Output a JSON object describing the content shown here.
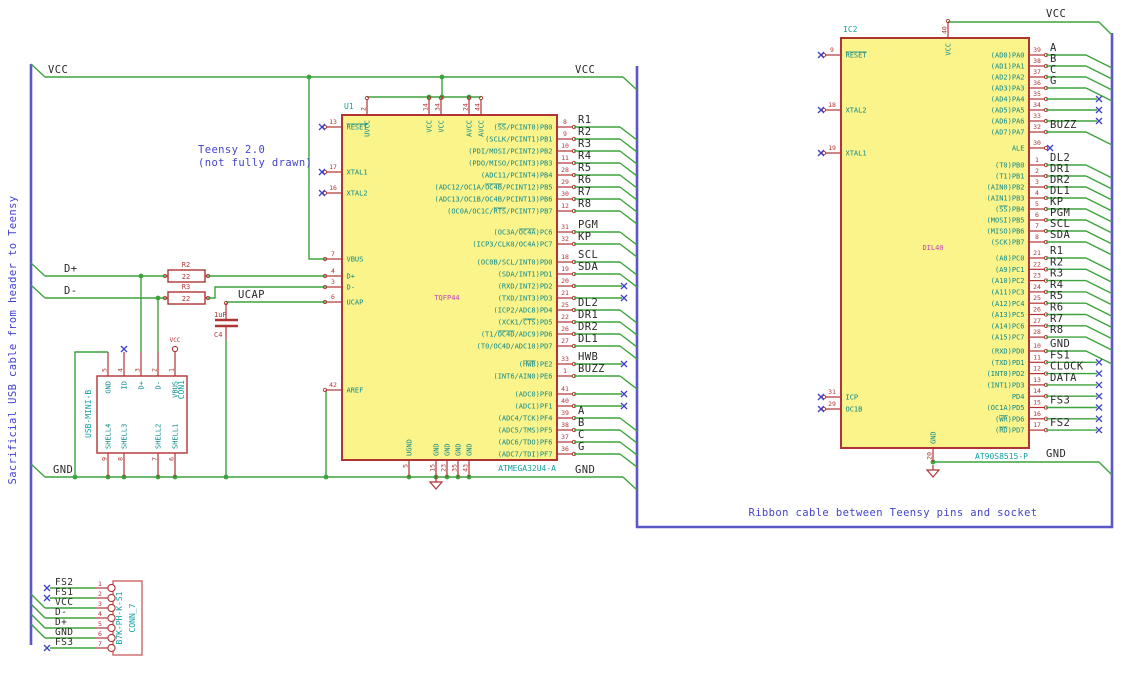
{
  "notes": {
    "sacrificial": "Sacrificial USB cable from header to Teensy",
    "teensy_line1": "Teensy 2.0",
    "teensy_line2": "(not fully drawn)",
    "ribbon": "Ribbon cable between Teensy pins and socket"
  },
  "net_labels": {
    "vcc": "VCC",
    "gnd": "GND",
    "ucap": "UCAP",
    "dplus": "D+",
    "dminus": "D-"
  },
  "u1": {
    "ref": "U1",
    "value": "ATMEGA32U4-A",
    "footprint": "TQFP44",
    "left_pins": [
      {
        "num": "13",
        "name": "|RESET|",
        "conn": "nc"
      },
      {
        "num": "17",
        "name": "XTAL1",
        "conn": "nc"
      },
      {
        "num": "16",
        "name": "XTAL2",
        "conn": "nc"
      },
      {
        "num": "7",
        "name": "VBUS",
        "conn": "wire"
      },
      {
        "num": "4",
        "name": "D+",
        "conn": "wire"
      },
      {
        "num": "3",
        "name": "D-",
        "conn": "wire"
      },
      {
        "num": "6",
        "name": "UCAP",
        "conn": "wire"
      },
      {
        "num": "42",
        "name": "AREF",
        "conn": "wire"
      }
    ],
    "top_pins": [
      {
        "num": "2",
        "name": "UVCC"
      },
      {
        "num": "14",
        "name": "VCC"
      },
      {
        "num": "34",
        "name": "VCC"
      },
      {
        "num": "24",
        "name": "AVCC"
      },
      {
        "num": "44",
        "name": "AVCC"
      }
    ],
    "bottom_pins": [
      {
        "num": "5",
        "name": "UGND"
      },
      {
        "num": "15",
        "name": "GND"
      },
      {
        "num": "23",
        "name": "GND"
      },
      {
        "num": "35",
        "name": "GND"
      },
      {
        "num": "43",
        "name": "GND"
      }
    ],
    "right_groups": [
      [
        {
          "num": "8",
          "name": "(|SS|/PCINT0)PB0",
          "net": "R1"
        },
        {
          "num": "9",
          "name": "(SCLK/PCINT1)PB1",
          "net": "R2"
        },
        {
          "num": "10",
          "name": "(PDI/MOSI/PCINT2)PB2",
          "net": "R3"
        },
        {
          "num": "11",
          "name": "(PDO/MISO/PCINT3)PB3",
          "net": "R4"
        },
        {
          "num": "28",
          "name": "(ADC11/PCINT4)PB4",
          "net": "R5"
        },
        {
          "num": "29",
          "name": "(ADC12/OC1A/|OC4B|/PCINT12)PB5",
          "net": "R6"
        },
        {
          "num": "30",
          "name": "(ADC13/OC1B/OC4B/PCINT13)PB6",
          "net": "R7"
        },
        {
          "num": "12",
          "name": "(OC0A/OC1C/|RTS|/PCINT7)PB7",
          "net": "R8"
        }
      ],
      [
        {
          "num": "31",
          "name": "(OC3A/|OC4A|)PC6",
          "net": "PGM"
        },
        {
          "num": "32",
          "name": "(ICP3/CLK0/OC4A)PC7",
          "net": "KP"
        }
      ],
      [
        {
          "num": "18",
          "name": "(OC0B/SCL/INT0)PD0",
          "net": "SCL"
        },
        {
          "num": "19",
          "name": "(SDA/INT1)PD1",
          "net": "SDA"
        },
        {
          "num": "20",
          "name": "(RXD/INT2)PD2",
          "conn": "nc"
        },
        {
          "num": "21",
          "name": "(TXD/INT3)PD3",
          "conn": "nc"
        },
        {
          "num": "25",
          "name": "(ICP2/ADC8)PD4",
          "net": "DL2"
        },
        {
          "num": "22",
          "name": "(XCK1/|CTS|)PD5",
          "net": "DR1"
        },
        {
          "num": "26",
          "name": "(T1/|OC4D|/ADC9)PD6",
          "net": "DR2"
        },
        {
          "num": "27",
          "name": "(T0/OC4D/ADC10)PD7",
          "net": "DL1"
        }
      ],
      [
        {
          "num": "33",
          "name": "(|HWB|)PE2",
          "net": "HWB",
          "conn": "nc"
        },
        {
          "num": "1",
          "name": "(INT6/AIN0)PE6",
          "net": "BUZZ"
        }
      ],
      [
        {
          "num": "41",
          "name": "(ADC0)PF0",
          "conn": "nc"
        },
        {
          "num": "40",
          "name": "(ADC1)PF1",
          "conn": "nc"
        },
        {
          "num": "39",
          "name": "(ADC4/TCK)PF4",
          "net": "A"
        },
        {
          "num": "38",
          "name": "(ADC5/TMS)PF5",
          "net": "B"
        },
        {
          "num": "37",
          "name": "(ADC6/TDO)PF6",
          "net": "C"
        },
        {
          "num": "36",
          "name": "(ADC7/TDI)PF7",
          "net": "G"
        }
      ]
    ]
  },
  "ic2": {
    "ref": "IC2",
    "value": "AT90S8515-P",
    "footprint": "DIL40",
    "left_pins": [
      {
        "num": "9",
        "name": "|RESET|",
        "conn": "nc"
      },
      {
        "num": "18",
        "name": "XTAL2",
        "conn": "nc"
      },
      {
        "num": "19",
        "name": "XTAL1",
        "conn": "nc"
      },
      {
        "num": "31",
        "name": "ICP",
        "conn": "nc"
      },
      {
        "num": "29",
        "name": "OC1B",
        "conn": "nc"
      }
    ],
    "top_pins": [
      {
        "num": "40",
        "name": "VCC"
      }
    ],
    "bottom_pins": [
      {
        "num": "20",
        "name": "GND"
      }
    ],
    "right_groups": [
      [
        {
          "num": "39",
          "name": "(AD0)PA0",
          "net": "A"
        },
        {
          "num": "38",
          "name": "(AD1)PA1",
          "net": "B"
        },
        {
          "num": "37",
          "name": "(AD2)PA2",
          "net": "C"
        },
        {
          "num": "36",
          "name": "(AD3)PA3",
          "net": "G"
        },
        {
          "num": "35",
          "name": "(AD4)PA4",
          "conn": "nc"
        },
        {
          "num": "34",
          "name": "(AD5)PA5",
          "conn": "nc"
        },
        {
          "num": "33",
          "name": "(AD6)PA6",
          "conn": "nc"
        },
        {
          "num": "32",
          "name": "(AD7)PA7",
          "net": "BUZZ"
        }
      ],
      [
        {
          "num": "30",
          "name": "ALE",
          "conn": "nc-short"
        }
      ],
      [
        {
          "num": "1",
          "name": "(T0)PB0",
          "net": "DL2"
        },
        {
          "num": "2",
          "name": "(T1)PB1",
          "net": "DR1"
        },
        {
          "num": "3",
          "name": "(AIN0)PB2",
          "net": "DR2"
        },
        {
          "num": "4",
          "name": "(AIN1)PB3",
          "net": "DL1"
        },
        {
          "num": "5",
          "name": "(|SS|)PB4",
          "net": "KP"
        },
        {
          "num": "6",
          "name": "(MOSI)PB5",
          "net": "PGM"
        },
        {
          "num": "7",
          "name": "(MISO)PB6",
          "net": "SCL"
        },
        {
          "num": "8",
          "name": "(SCK)PB7",
          "net": "SDA"
        }
      ],
      [
        {
          "num": "21",
          "name": "(A8)PC0",
          "net": "R1"
        },
        {
          "num": "22",
          "name": "(A9)PC1",
          "net": "R2"
        },
        {
          "num": "23",
          "name": "(A10)PC2",
          "net": "R3"
        },
        {
          "num": "24",
          "name": "(A11)PC3",
          "net": "R4"
        },
        {
          "num": "25",
          "name": "(A12)PC4",
          "net": "R5"
        },
        {
          "num": "26",
          "name": "(A13)PC5",
          "net": "R6"
        },
        {
          "num": "27",
          "name": "(A14)PC6",
          "net": "R7"
        },
        {
          "num": "28",
          "name": "(A15)PC7",
          "net": "R8"
        }
      ],
      [
        {
          "num": "10",
          "name": "(RXD)PD0",
          "net": "GND"
        },
        {
          "num": "11",
          "name": "(TXD)PD1",
          "net": "FS1",
          "conn": "nc"
        },
        {
          "num": "12",
          "name": "(INT0)PD2",
          "net": "CLOCK",
          "conn": "nc"
        },
        {
          "num": "13",
          "name": "(INT1)PD3",
          "net": "DATA",
          "conn": "nc"
        },
        {
          "num": "14",
          "name": "PD4",
          "conn": "nc"
        },
        {
          "num": "15",
          "name": "(OC1A)PD5",
          "net": "FS3",
          "conn": "nc"
        },
        {
          "num": "16",
          "name": "(|WR|)PD6",
          "conn": "nc"
        },
        {
          "num": "17",
          "name": "(|RD|)PD7",
          "net": "FS2",
          "conn": "nc"
        }
      ]
    ]
  },
  "con1": {
    "ref": "CON1",
    "value": "USB-MINI-B",
    "top_pins": [
      {
        "num": "5",
        "name": "GND"
      },
      {
        "num": "4",
        "name": "ID"
      },
      {
        "num": "3",
        "name": "D+"
      },
      {
        "num": "2",
        "name": "D-"
      },
      {
        "num": "1",
        "name": "VBUS"
      }
    ],
    "bottom_pins": [
      {
        "num": "9",
        "name": "SHELL4"
      },
      {
        "num": "8",
        "name": "SHELL3"
      },
      {
        "num": "7",
        "name": "SHELL2"
      },
      {
        "num": "6",
        "name": "SHELL1"
      }
    ]
  },
  "conn7": {
    "ref": "CONN_7",
    "value": "B7K-PH-K-S1",
    "pins": [
      {
        "num": "1",
        "net": "FS2",
        "conn": "nc"
      },
      {
        "num": "2",
        "net": "FS1",
        "conn": "nc"
      },
      {
        "num": "3",
        "net": "VCC",
        "conn": "bus"
      },
      {
        "num": "4",
        "net": "D-",
        "conn": "bus"
      },
      {
        "num": "5",
        "net": "D+",
        "conn": "bus"
      },
      {
        "num": "6",
        "net": "GND",
        "conn": "bus"
      },
      {
        "num": "7",
        "net": "FS3",
        "conn": "nc"
      }
    ]
  },
  "r2": {
    "ref": "R2",
    "value": "22"
  },
  "r3": {
    "ref": "R3",
    "value": "22"
  },
  "c4": {
    "ref": "C4",
    "value": "1uF"
  },
  "colors": {
    "wire": "#3da33d",
    "bus": "#5b57c8",
    "pin": "#b03434",
    "name": "#0e8989",
    "label": "#2a2a2a",
    "ref": "#12a0a0",
    "fp": "#c040c0",
    "note": "#4343cc",
    "nc": "#4040c8",
    "fill": "#fbf48b"
  }
}
